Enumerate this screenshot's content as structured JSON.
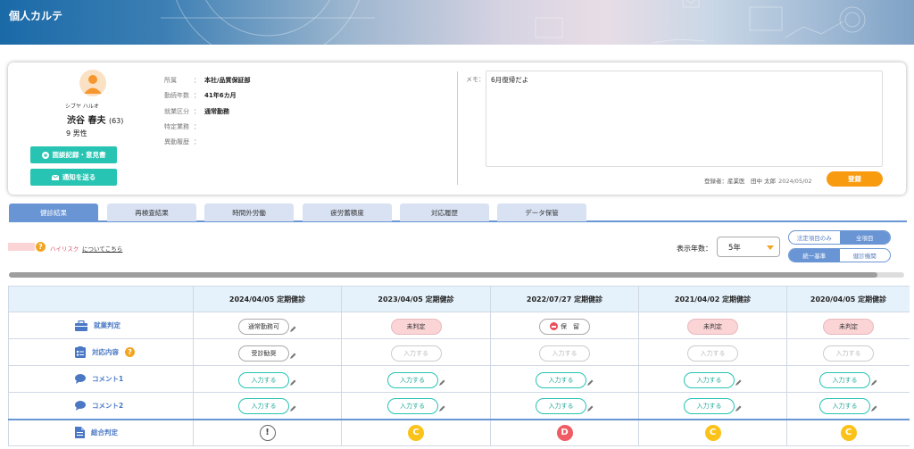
{
  "app": {
    "title": "個人カルテ"
  },
  "profile": {
    "kana": "シブヤ ハルオ",
    "name": "渋谷 春夫",
    "age": "(63)",
    "info_line": "9  男性",
    "buttons": {
      "consult": "面談記録・意見書",
      "notify": "通知を送る"
    },
    "fields": [
      {
        "label": "所属",
        "value": "本社/品質保証部"
      },
      {
        "label": "勤続年数",
        "value": "41年6カ月"
      },
      {
        "label": "就業区分",
        "value": "通常勤務"
      },
      {
        "label": "特定業務",
        "value": ""
      },
      {
        "label": "異動履歴",
        "value": ""
      }
    ],
    "memo_label": "メモ：",
    "memo_value": "6月復帰だよ",
    "registered_by": "登録者：産業医　田中 太郎",
    "registered_date": "2024/05/02",
    "register_button": "登録"
  },
  "tabs": [
    "健診結果",
    "再検査結果",
    "時間外労働",
    "疲労蓄積度",
    "対応履歴",
    "データ保管"
  ],
  "active_tab": 0,
  "filters": {
    "risk_label": "ハイリスク",
    "risk_link": "についてこちら",
    "years_label": "表示年数：",
    "years_value": "5年",
    "toggle1": [
      "法定項目のみ",
      "全項目"
    ],
    "toggle2": [
      "統一基準",
      "健診機関"
    ]
  },
  "table": {
    "columns": [
      "2024/04/05  定期健診",
      "2023/04/05  定期健診",
      "2022/07/27  定期健診",
      "2021/04/02  定期健診",
      "2020/04/05  定期健診"
    ],
    "rows": [
      {
        "label": "就業判定",
        "icon": "briefcase-icon",
        "cells": [
          {
            "text": "通常勤務可",
            "style": "white"
          },
          {
            "text": "未判定",
            "style": "red"
          },
          {
            "text": "保　留",
            "style": "hold"
          },
          {
            "text": "未判定",
            "style": "red"
          },
          {
            "text": "未判定",
            "style": "red"
          }
        ]
      },
      {
        "label": "対応内容",
        "icon": "checklist-icon",
        "help": "?",
        "cells": [
          {
            "text": "受診勧奨",
            "style": "white"
          },
          {
            "text": "入力する",
            "style": "dis"
          },
          {
            "text": "入力する",
            "style": "dis"
          },
          {
            "text": "入力する",
            "style": "dis"
          },
          {
            "text": "入力する",
            "style": "dis"
          }
        ]
      },
      {
        "label": "コメント1",
        "icon": "comment-icon",
        "cells": [
          {
            "text": "入力する",
            "style": "teal"
          },
          {
            "text": "入力する",
            "style": "teal"
          },
          {
            "text": "入力する",
            "style": "teal"
          },
          {
            "text": "入力する",
            "style": "teal"
          },
          {
            "text": "入力する",
            "style": "teal"
          }
        ]
      },
      {
        "label": "コメント2",
        "icon": "comment-icon",
        "cells": [
          {
            "text": "入力する",
            "style": "teal"
          },
          {
            "text": "入力する",
            "style": "teal"
          },
          {
            "text": "入力する",
            "style": "teal"
          },
          {
            "text": "入力する",
            "style": "teal"
          },
          {
            "text": "入力する",
            "style": "teal"
          }
        ]
      },
      {
        "label": "総合判定",
        "icon": "document-icon",
        "cells": [
          {
            "text": "!",
            "style": "gI"
          },
          {
            "text": "C",
            "style": "gC"
          },
          {
            "text": "D",
            "style": "gD"
          },
          {
            "text": "C",
            "style": "gC"
          },
          {
            "text": "C",
            "style": "gC"
          }
        ]
      }
    ]
  },
  "colors": {
    "accent": "#6a95d4",
    "teal": "#27c4b3",
    "orange": "#f99b0f",
    "grade_c": "#fbc21a",
    "grade_d": "#f05c63"
  }
}
